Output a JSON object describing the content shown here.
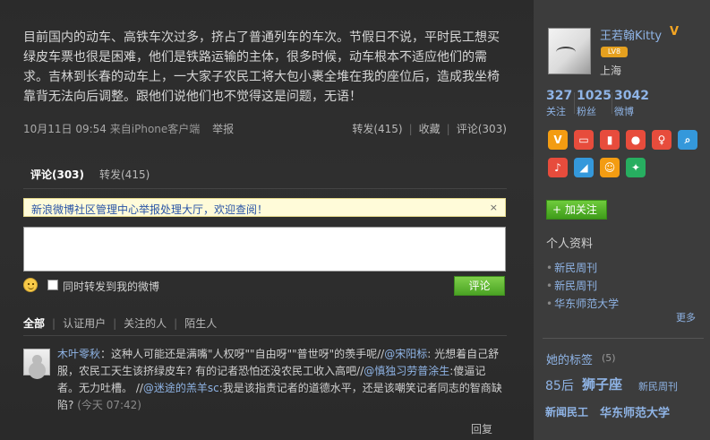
{
  "post": {
    "text": "目前国内的动车、高铁车次过多，挤占了普通列车的车次。节假日不说，平时民工想买绿皮车票也很是困难，他们是铁路运输的主体，很多时候，动车根本不适应他们的需求。吉林到长春的动车上，一大家子农民工将大包小裹全堆在我的座位后，造成我坐椅靠背无法向后调整。跟他们说他们也不觉得这是问题，无语！",
    "date": "10月11日 09:54",
    "source": "来自iPhone客户端",
    "report": "举报",
    "repost": "转发(415)",
    "favorite": "收藏",
    "comment": "评论(303)"
  },
  "tabs": {
    "comments": "评论(303)",
    "reposts": "转发(415)"
  },
  "notice": {
    "text": "新浪微博社区管理中心举报处理大厅，欢迎查阅！",
    "close": "×"
  },
  "composer": {
    "also_repost": "同时转发到我的微博",
    "submit": "评论"
  },
  "filters": [
    "全部",
    "认证用户",
    "关注的人",
    "陌生人"
  ],
  "comment_item": {
    "user": "木叶零秋",
    "part1": "：这种人可能还是满嘴\"人权呀\"\"自由呀\"\"普世呀\"的羡手呢//",
    "mention1": "@宋阳标",
    "part2": ": 光想着自己舒服，农民工天生该挤绿皮车? 有的记者恐怕还没农民工收入高吧//",
    "mention2": "@慎独习劳普涂生",
    "part3": ":傻逼记者。无力吐槽。 //",
    "mention3": "@迷途的羔羊sc",
    "part4": ":我是该指责记者的道德水平，还是该嘲笑记者同志的智商缺陷?",
    "time": "(今天 07:42)",
    "reply": "回复"
  },
  "profile": {
    "name": "王若翰Kitty",
    "verified_icon": "V",
    "level": "LV8",
    "location": "上海",
    "following": "327",
    "following_label": "关注",
    "fans": "1025",
    "fans_label": "粉丝",
    "weibo": "3042",
    "weibo_label": "微博",
    "follow_button": "+ 加关注",
    "info_title": "个人资料",
    "info_items": [
      "新民周刊",
      "新民周刊",
      "华东师范大学"
    ],
    "more": "更多",
    "tags_title": "她的标签",
    "tags_count": "(5)",
    "tags": [
      "85后",
      "狮子座",
      "新民周刊",
      "新闻民工",
      "华东师范大学"
    ]
  },
  "app_icons": [
    {
      "name": "vip-icon",
      "glyph": "V",
      "color": "#f39c12"
    },
    {
      "name": "tv-icon",
      "glyph": "▭",
      "color": "#e74c3c"
    },
    {
      "name": "chart-icon",
      "glyph": "▮",
      "color": "#e74c3c"
    },
    {
      "name": "chat-icon",
      "glyph": "●",
      "color": "#e74c3c"
    },
    {
      "name": "female-icon",
      "glyph": "♀",
      "color": "#e74c3c"
    },
    {
      "name": "search-app-icon",
      "glyph": "⌕",
      "color": "#3498db"
    },
    {
      "name": "mic-icon",
      "glyph": "♪",
      "color": "#e74c3c"
    },
    {
      "name": "photo-icon",
      "glyph": "◢",
      "color": "#3498db"
    },
    {
      "name": "smile-app-icon",
      "glyph": "☺",
      "color": "#f39c12"
    },
    {
      "name": "game-icon",
      "glyph": "✦",
      "color": "#27ae60"
    }
  ]
}
